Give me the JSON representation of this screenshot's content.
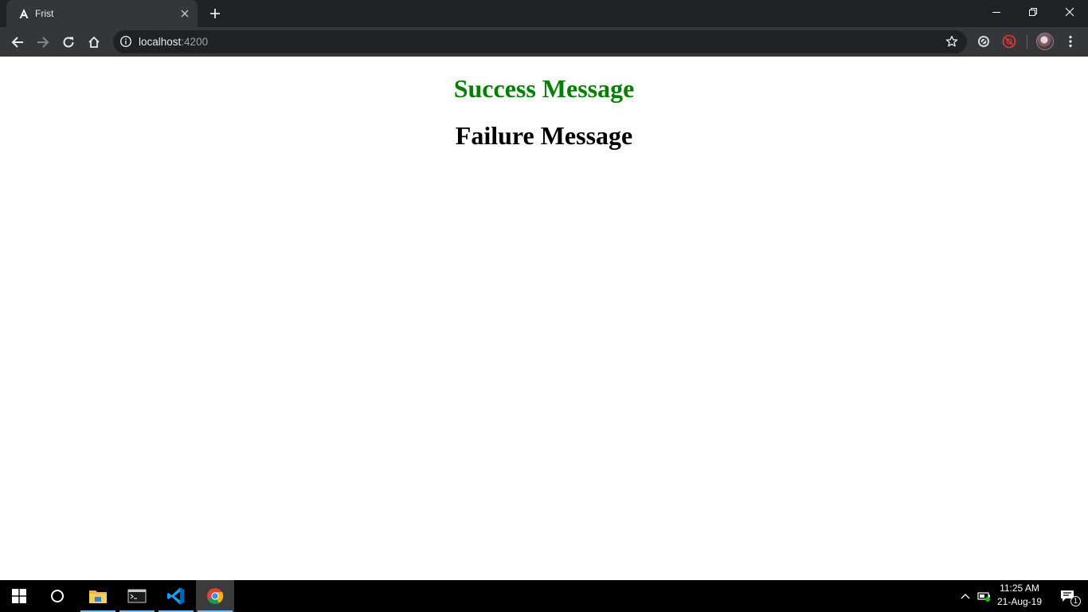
{
  "browser": {
    "tab": {
      "title": "Frist"
    },
    "address": {
      "host": "localhost",
      "port": ":4200"
    }
  },
  "page": {
    "success_message": "Success Message",
    "failure_message": "Failure Message"
  },
  "taskbar": {
    "apps": [
      {
        "icon": "file-explorer-icon"
      },
      {
        "icon": "terminal-icon"
      },
      {
        "icon": "vscode-icon"
      },
      {
        "icon": "chrome-icon"
      }
    ],
    "clock": {
      "time": "11:25 AM",
      "date": "21-Aug-19"
    },
    "notification_count": "1"
  },
  "colors": {
    "success": "#008000",
    "failure": "#000000",
    "chrome_dark": "#202124",
    "chrome_toolbar": "#35363a",
    "taskbar": "#000000"
  }
}
